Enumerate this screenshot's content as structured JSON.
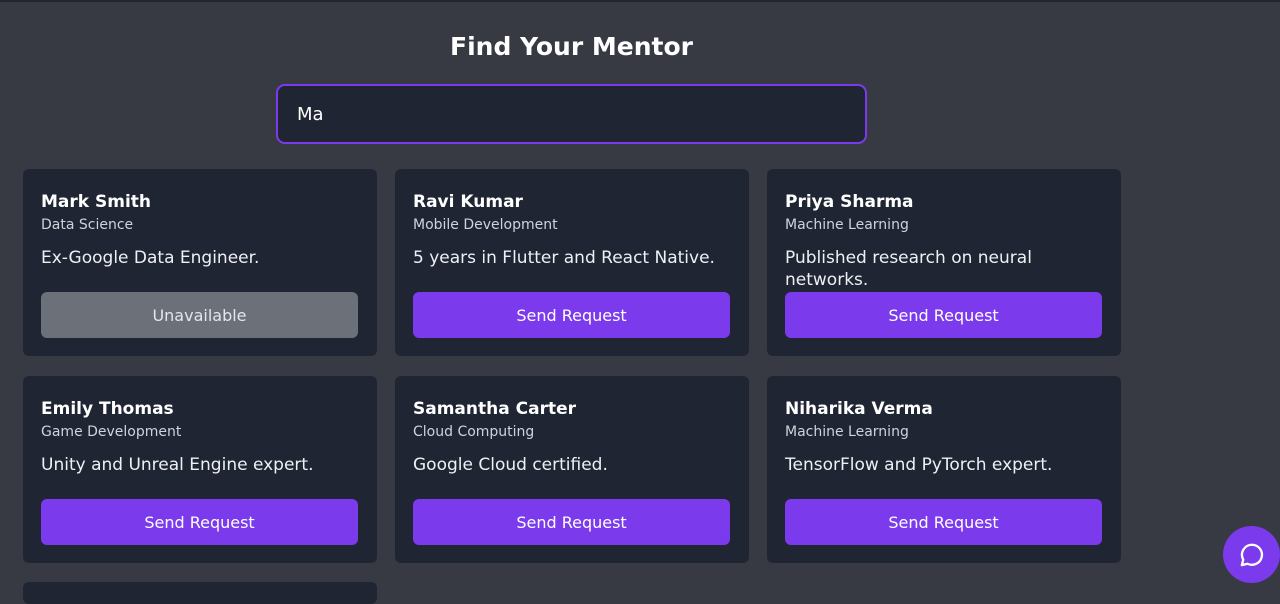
{
  "page": {
    "title": "Find Your Mentor"
  },
  "search": {
    "value": "Ma",
    "placeholder": ""
  },
  "mentors": [
    {
      "name": "Mark Smith",
      "field": "Data Science",
      "description": "Ex-Google Data Engineer.",
      "button_label": "Unavailable",
      "available": false
    },
    {
      "name": "Ravi Kumar",
      "field": "Mobile Development",
      "description": "5 years in Flutter and React Native.",
      "button_label": "Send Request",
      "available": true
    },
    {
      "name": "Priya Sharma",
      "field": "Machine Learning",
      "description": "Published research on neural networks.",
      "button_label": "Send Request",
      "available": true
    },
    {
      "name": "Emily Thomas",
      "field": "Game Development",
      "description": "Unity and Unreal Engine expert.",
      "button_label": "Send Request",
      "available": true
    },
    {
      "name": "Samantha Carter",
      "field": "Cloud Computing",
      "description": "Google Cloud certified.",
      "button_label": "Send Request",
      "available": true
    },
    {
      "name": "Niharika Verma",
      "field": "Machine Learning",
      "description": "TensorFlow and PyTorch expert.",
      "button_label": "Send Request",
      "available": true
    }
  ],
  "chat": {
    "icon": "chat-bubble-icon"
  },
  "colors": {
    "background": "#373a42",
    "card": "#1f2532",
    "accent": "#7c3aed",
    "disabled_button": "#6b7079"
  }
}
